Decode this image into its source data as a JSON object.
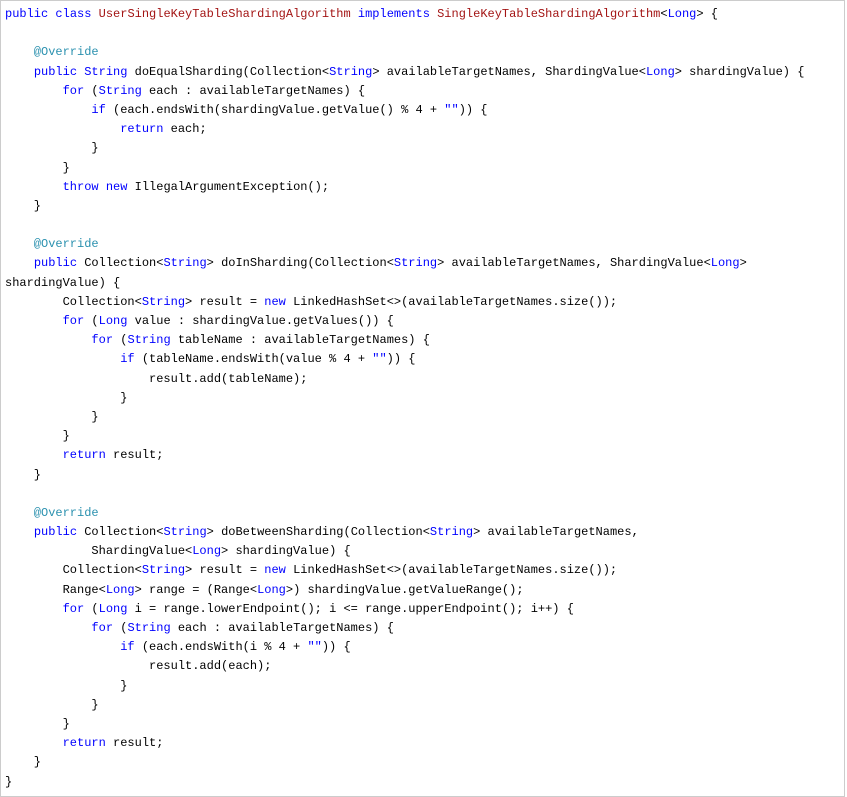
{
  "code": {
    "line01_a": "public",
    "line01_b": " ",
    "line01_c": "class",
    "line01_d": " ",
    "line01_e": "UserSingleKeyTableShardingAlgorithm",
    "line01_f": " ",
    "line01_g": "implements",
    "line01_h": " ",
    "line01_i": "SingleKeyTableShardingAlgorithm",
    "line01_j": "<",
    "line01_k": "Long",
    "line01_l": "> {",
    "line03": "    @Override",
    "line04_a": "    ",
    "line04_b": "public",
    "line04_c": " ",
    "line04_d": "String",
    "line04_e": " doEqualSharding(Collection<",
    "line04_f": "String",
    "line04_g": "> availableTargetNames, ShardingValue<",
    "line04_h": "Long",
    "line04_i": "> shardingValue) {",
    "line05_a": "        ",
    "line05_b": "for",
    "line05_c": " (",
    "line05_d": "String",
    "line05_e": " each : availableTargetNames) {",
    "line06_a": "            ",
    "line06_b": "if",
    "line06_c": " (each.endsWith(shardingValue.getValue() % 4 + ",
    "line06_d": "\"\"",
    "line06_e": ")) {",
    "line07_a": "                ",
    "line07_b": "return",
    "line07_c": " each;",
    "line08": "            }",
    "line09": "        }",
    "line10_a": "        ",
    "line10_b": "throw",
    "line10_c": " ",
    "line10_d": "new",
    "line10_e": " IllegalArgumentException();",
    "line11": "    }",
    "line13": "    @Override",
    "line14_a": "    ",
    "line14_b": "public",
    "line14_c": " Collection<",
    "line14_d": "String",
    "line14_e": "> doInSharding(Collection<",
    "line14_f": "String",
    "line14_g": "> availableTargetNames, ShardingValue<",
    "line14_h": "Long",
    "line14_i": "> ",
    "line14b": "shardingValue) {",
    "line15_a": "        Collection<",
    "line15_b": "String",
    "line15_c": "> result = ",
    "line15_d": "new",
    "line15_e": " LinkedHashSet<>(availableTargetNames.size());",
    "line16_a": "        ",
    "line16_b": "for",
    "line16_c": " (",
    "line16_d": "Long",
    "line16_e": " value : shardingValue.getValues()) {",
    "line17_a": "            ",
    "line17_b": "for",
    "line17_c": " (",
    "line17_d": "String",
    "line17_e": " tableName : availableTargetNames) {",
    "line18_a": "                ",
    "line18_b": "if",
    "line18_c": " (tableName.endsWith(value % 4 + ",
    "line18_d": "\"\"",
    "line18_e": ")) {",
    "line19": "                    result.add(tableName);",
    "line20": "                }",
    "line21": "            }",
    "line22": "        }",
    "line23_a": "        ",
    "line23_b": "return",
    "line23_c": " result;",
    "line24": "    }",
    "line26": "    @Override",
    "line27_a": "    ",
    "line27_b": "public",
    "line27_c": " Collection<",
    "line27_d": "String",
    "line27_e": "> doBetweenSharding(Collection<",
    "line27_f": "String",
    "line27_g": "> availableTargetNames,",
    "line28_a": "            ShardingValue<",
    "line28_b": "Long",
    "line28_c": "> shardingValue) {",
    "line29_a": "        Collection<",
    "line29_b": "String",
    "line29_c": "> result = ",
    "line29_d": "new",
    "line29_e": " LinkedHashSet<>(availableTargetNames.size());",
    "line30_a": "        Range<",
    "line30_b": "Long",
    "line30_c": "> range = (Range<",
    "line30_d": "Long",
    "line30_e": ">) shardingValue.getValueRange();",
    "line31_a": "        ",
    "line31_b": "for",
    "line31_c": " (",
    "line31_d": "Long",
    "line31_e": " i = range.lowerEndpoint(); i <= range.upperEndpoint(); i++) {",
    "line32_a": "            ",
    "line32_b": "for",
    "line32_c": " (",
    "line32_d": "String",
    "line32_e": " each : availableTargetNames) {",
    "line33_a": "                ",
    "line33_b": "if",
    "line33_c": " (each.endsWith(i % 4 + ",
    "line33_d": "\"\"",
    "line33_e": ")) {",
    "line34": "                    result.add(each);",
    "line35": "                }",
    "line36": "            }",
    "line37": "        }",
    "line38_a": "        ",
    "line38_b": "return",
    "line38_c": " result;",
    "line39": "    }",
    "line40": "}"
  }
}
